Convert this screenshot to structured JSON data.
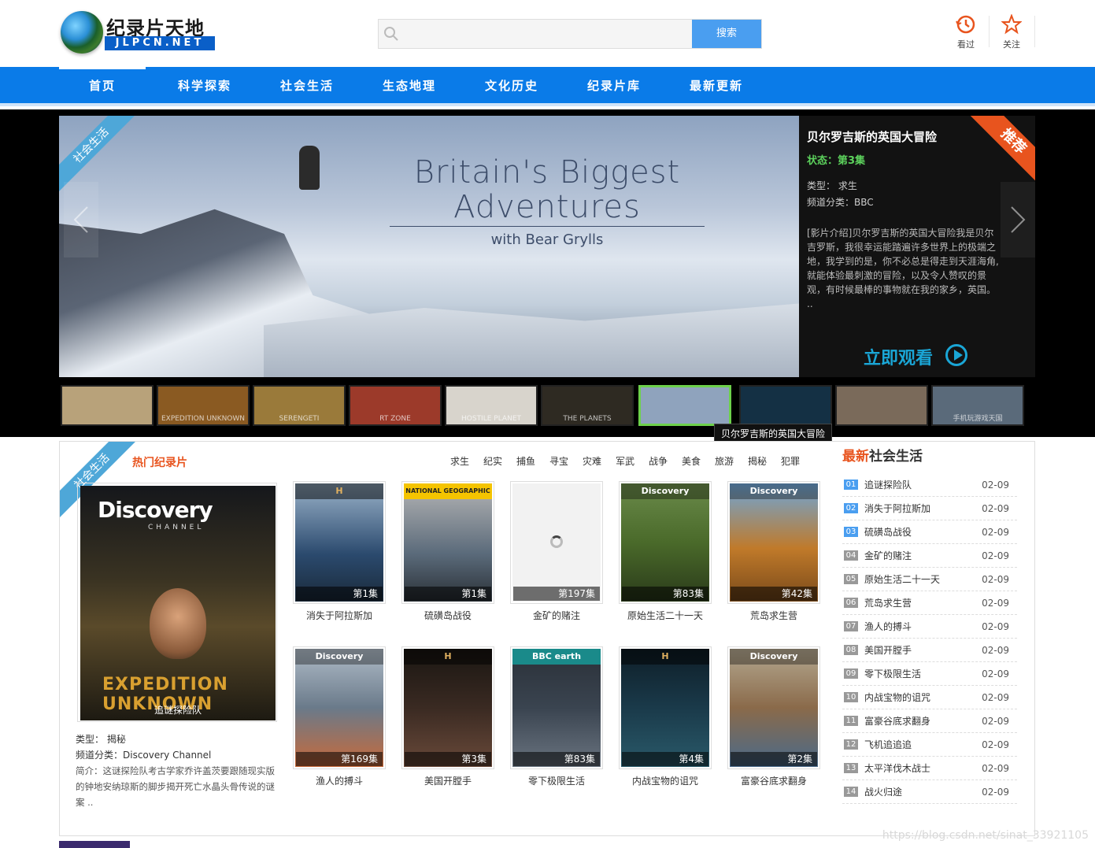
{
  "header": {
    "logo_cn": "纪录片天地",
    "logo_en": "JLPCN.NET",
    "search_placeholder": "",
    "search_button": "搜索",
    "history_label": "看过",
    "follow_label": "关注"
  },
  "nav": {
    "items": [
      "首页",
      "科学探索",
      "社会生活",
      "生态地理",
      "文化历史",
      "纪录片库",
      "最新更新"
    ]
  },
  "banner": {
    "ribbon": "社会生活",
    "corner": "推荐",
    "hero_title": "Britain's Biggest Adventures",
    "hero_sub": "with Bear Grylls",
    "title": "贝尔罗吉斯的英国大冒险",
    "status": "状态：第3集",
    "type": "类型： 求生",
    "channel": "频道分类：BBC",
    "desc": "[影片介绍]贝尔罗吉斯的英国大冒险我是贝尔吉罗斯，我很幸运能踏遍许多世界上的极端之地，我学到的是，你不必总是得走到天涯海角,就能体验最刺激的冒险，以及令人赞叹的景观，有时候最棒的事物就在我的家乡，英国。 ..",
    "watch": "立即观看",
    "tooltip": "贝尔罗吉斯的英国大冒险",
    "thumbs": [
      {
        "label": "",
        "color": "#b8a27a"
      },
      {
        "label": "EXPEDITION UNKNOWN",
        "color": "#8a5a22"
      },
      {
        "label": "SERENGETI",
        "color": "#9a7a3a"
      },
      {
        "label": "RT ZONE",
        "color": "#9c3a2a"
      },
      {
        "label": "HOSTILE PLANET",
        "color": "#d8d4cc"
      },
      {
        "label": "THE PLANETS",
        "color": "#2e2a22"
      },
      {
        "label": "",
        "color": "#8fa3bd"
      },
      {
        "label": "",
        "color": "#143044"
      },
      {
        "label": "",
        "color": "#7a6a5a"
      },
      {
        "label": "手机玩游戏天国",
        "color": "#5a6a7a"
      }
    ]
  },
  "section": {
    "ribbon": "社会生活",
    "hot_title": "热门纪录片",
    "tags": [
      "求生",
      "纪实",
      "捕鱼",
      "寻宝",
      "灾难",
      "军武",
      "战争",
      "美食",
      "旅游",
      "揭秘",
      "犯罪"
    ],
    "featured": {
      "brand": "Discovery",
      "channel_word": "CHANNEL",
      "title_art": "EXPEDITION UNKNOWN",
      "caption": "追谜探险队",
      "type": "类型： 揭秘",
      "channel": "频道分类：Discovery Channel",
      "desc": "简介：这谜探险队考古学家乔许盖茨要跟随现实版的钟地安纳琼斯的脚步揭开死亡水晶头骨传说的谜案 .."
    },
    "cards": [
      {
        "name": "消失于阿拉斯加",
        "ep": "第1集",
        "brand": "H",
        "color": "#2b4a6e"
      },
      {
        "name": "硫磺岛战役",
        "ep": "第1集",
        "brand": "NATIONAL GEOGRAPHIC",
        "color": "#4a5a6a"
      },
      {
        "name": "金矿的赌注",
        "ep": "第197集",
        "brand": "",
        "color": "#f2f2f2"
      },
      {
        "name": "原始生活二十一天",
        "ep": "第83集",
        "brand": "Discovery",
        "color": "#4a6a2a"
      },
      {
        "name": "荒岛求生营",
        "ep": "第42集",
        "brand": "Discovery",
        "color": "#c07a2a"
      },
      {
        "name": "渔人的搏斗",
        "ep": "第169集",
        "brand": "Discovery",
        "color": "#6a7a8a"
      },
      {
        "name": "美国开膛手",
        "ep": "第3集",
        "brand": "H",
        "color": "#3a2a22"
      },
      {
        "name": "零下极限生活",
        "ep": "第83集",
        "brand": "BBC earth",
        "color": "#3a4450"
      },
      {
        "name": "内战宝物的诅咒",
        "ep": "第4集",
        "brand": "H",
        "color": "#1a3a4a"
      },
      {
        "name": "富豪谷底求翻身",
        "ep": "第2集",
        "brand": "Discovery",
        "color": "#8a6a4a"
      }
    ],
    "latest_title_red": "最新",
    "latest_title_rest": "社会生活",
    "latest": [
      {
        "n": "01",
        "t": "追谜探险队",
        "d": "02-09"
      },
      {
        "n": "02",
        "t": "消失于阿拉斯加",
        "d": "02-09"
      },
      {
        "n": "03",
        "t": "硫磺岛战役",
        "d": "02-09"
      },
      {
        "n": "04",
        "t": "金矿的赌注",
        "d": "02-09"
      },
      {
        "n": "05",
        "t": "原始生活二十一天",
        "d": "02-09"
      },
      {
        "n": "06",
        "t": "荒岛求生营",
        "d": "02-09"
      },
      {
        "n": "07",
        "t": "渔人的搏斗",
        "d": "02-09"
      },
      {
        "n": "08",
        "t": "美国开膛手",
        "d": "02-09"
      },
      {
        "n": "09",
        "t": "零下极限生活",
        "d": "02-09"
      },
      {
        "n": "10",
        "t": "内战宝物的诅咒",
        "d": "02-09"
      },
      {
        "n": "11",
        "t": "富豪谷底求翻身",
        "d": "02-09"
      },
      {
        "n": "12",
        "t": "飞机追追追",
        "d": "02-09"
      },
      {
        "n": "13",
        "t": "太平洋伐木战士",
        "d": "02-09"
      },
      {
        "n": "14",
        "t": "战火归途",
        "d": "02-09"
      }
    ]
  },
  "footer": {
    "watermark": "https://blog.csdn.net/sinat_33921105"
  },
  "colors": {
    "nav_blue": "#0a7be8",
    "accent_orange": "#e8541e",
    "ribbon_blue": "#4ea7d8",
    "thumb_active": "#6dd14b",
    "watch_cyan": "#1aa6d6"
  }
}
